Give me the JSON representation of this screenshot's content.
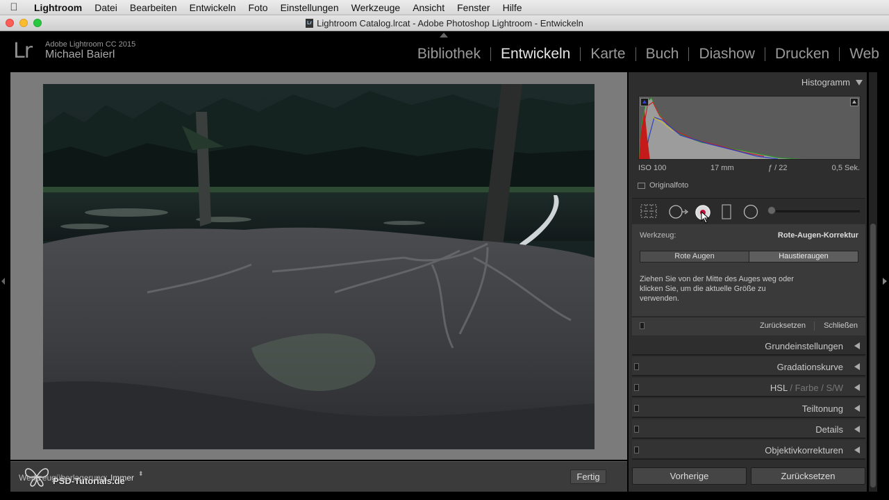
{
  "menubar": {
    "apple": "",
    "items": [
      "Lightroom",
      "Datei",
      "Bearbeiten",
      "Entwickeln",
      "Foto",
      "Einstellungen",
      "Werkzeuge",
      "Ansicht",
      "Fenster",
      "Hilfe"
    ]
  },
  "window": {
    "doc_icon": "Lr",
    "title": "Lightroom Catalog.lrcat - Adobe Photoshop Lightroom - Entwickeln"
  },
  "identity": {
    "logo": "Lr",
    "product": "Adobe Lightroom CC 2015",
    "user": "Michael Baierl"
  },
  "modules": [
    "Bibliothek",
    "Entwickeln",
    "Karte",
    "Buch",
    "Diashow",
    "Drucken",
    "Web"
  ],
  "active_module": "Entwickeln",
  "histogram": {
    "title": "Histogramm",
    "iso": "ISO 100",
    "focal": "17 mm",
    "aperture": "ƒ / 22",
    "shutter": "0,5 Sek.",
    "original_label": "Originalfoto"
  },
  "tools": {
    "icons": [
      "crop-overlay-icon",
      "spot-removal-icon",
      "red-eye-icon",
      "graduated-filter-icon",
      "radial-filter-icon"
    ]
  },
  "redeye": {
    "tool_label": "Werkzeug:",
    "tool_value": "Rote-Augen-Korrektur",
    "mode_red": "Rote Augen",
    "mode_pet": "Haustieraugen",
    "hint": "Ziehen Sie von der Mitte des Auges weg oder klicken Sie, um die aktuelle Größe zu verwenden.",
    "reset": "Zurücksetzen",
    "close": "Schließen"
  },
  "sections": {
    "basic": "Grundeinstellungen",
    "tone_curve": "Gradationskurve",
    "hsl": "HSL",
    "hsl_sep1": "/",
    "color": "Farbe",
    "hsl_sep2": "/",
    "bw": "S/W",
    "split_toning": "Teiltonung",
    "details": "Details",
    "lens": "Objektivkorrekturen"
  },
  "toolbar": {
    "overlay_label": "Werkzeugüberlagerung:",
    "overlay_value": "Immer",
    "stepper": "⬍",
    "done": "Fertig",
    "watermark": "PSD-Tutorials.de"
  },
  "bottom": {
    "previous": "Vorherige",
    "reset": "Zurücksetzen"
  },
  "colors": {
    "active_module": "#e6e6e6",
    "panel_bg": "#2e2e2e",
    "red_eye_accent": "#c8103c"
  }
}
